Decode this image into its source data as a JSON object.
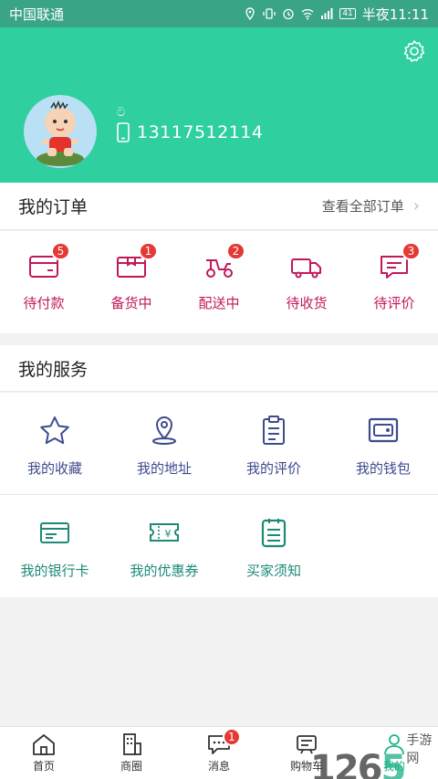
{
  "status_bar": {
    "carrier": "中国联通",
    "battery": "41",
    "time": "半夜11:11"
  },
  "profile": {
    "nickname_glyph": "ට",
    "phone": "13117512114"
  },
  "orders": {
    "title": "我的订单",
    "view_all": "查看全部订单",
    "items": [
      {
        "label": "待付款",
        "badge": "5",
        "icon": "wallet-icon"
      },
      {
        "label": "备货中",
        "badge": "1",
        "icon": "box-icon"
      },
      {
        "label": "配送中",
        "badge": "2",
        "icon": "scooter-icon"
      },
      {
        "label": "待收货",
        "badge": "",
        "icon": "truck-icon"
      },
      {
        "label": "待评价",
        "badge": "3",
        "icon": "comment-icon"
      }
    ]
  },
  "services": {
    "title": "我的服务",
    "row1": [
      {
        "label": "我的收藏",
        "icon": "star-icon"
      },
      {
        "label": "我的地址",
        "icon": "location-icon"
      },
      {
        "label": "我的评价",
        "icon": "clipboard-icon"
      },
      {
        "label": "我的钱包",
        "icon": "wallet-icon"
      }
    ],
    "row2": [
      {
        "label": "我的银行卡",
        "icon": "bank-card-icon"
      },
      {
        "label": "我的优惠券",
        "icon": "coupon-icon"
      },
      {
        "label": "买家须知",
        "icon": "notice-icon"
      }
    ]
  },
  "tabbar": {
    "items": [
      {
        "label": "首页",
        "icon": "home-icon"
      },
      {
        "label": "商圈",
        "icon": "building-icon"
      },
      {
        "label": "消息",
        "icon": "chat-icon",
        "badge": "1"
      },
      {
        "label": "购物车",
        "icon": "cart-icon"
      },
      {
        "label": "我的",
        "icon": "person-icon"
      }
    ]
  },
  "watermark": {
    "number_a": "12",
    "number_b": "6",
    "number_c": "5",
    "site": "手游网"
  },
  "colors": {
    "header": "#2fcfa0",
    "order_accent": "#c2185b",
    "service_row1": "#3f4b8c",
    "service_row2": "#1d8a78",
    "badge": "#e53935",
    "tab_active": "#1fb58a"
  }
}
